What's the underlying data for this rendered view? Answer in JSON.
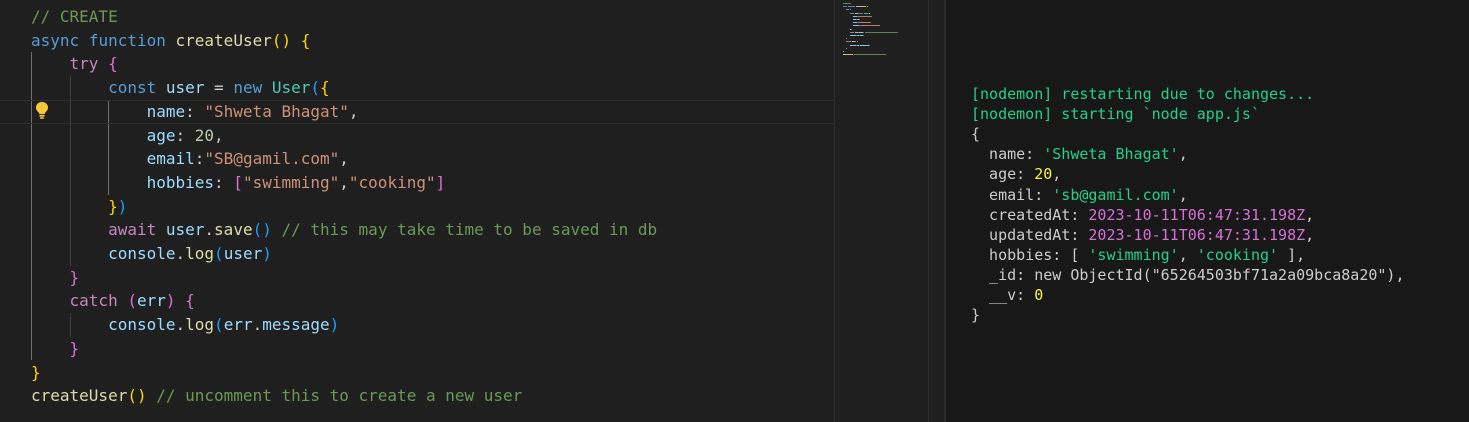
{
  "editor": {
    "lines": [
      {
        "tokens": [
          {
            "t": "// CREATE",
            "c": "t-cm"
          }
        ]
      },
      {
        "tokens": [
          {
            "t": "async",
            "c": "t-kw"
          },
          {
            "t": " "
          },
          {
            "t": "function",
            "c": "t-kw"
          },
          {
            "t": " "
          },
          {
            "t": "createUser",
            "c": "t-fn"
          },
          {
            "t": "()",
            "c": "b1"
          },
          {
            "t": " "
          },
          {
            "t": "{",
            "c": "b1"
          }
        ]
      },
      {
        "tokens": [
          {
            "t": "    "
          },
          {
            "t": "try",
            "c": "t-ctl"
          },
          {
            "t": " "
          },
          {
            "t": "{",
            "c": "b2"
          }
        ]
      },
      {
        "tokens": [
          {
            "t": "        "
          },
          {
            "t": "const",
            "c": "t-kw"
          },
          {
            "t": " "
          },
          {
            "t": "user",
            "c": "t-var"
          },
          {
            "t": " = "
          },
          {
            "t": "new",
            "c": "t-kw"
          },
          {
            "t": " "
          },
          {
            "t": "User",
            "c": "t-cls"
          },
          {
            "t": "(",
            "c": "b3"
          },
          {
            "t": "{",
            "c": "b1"
          }
        ]
      },
      {
        "tokens": [
          {
            "t": "            "
          },
          {
            "t": "name",
            "c": "t-var"
          },
          {
            "t": ": "
          },
          {
            "t": "\"Shweta Bhagat\"",
            "c": "t-str"
          },
          {
            "t": ","
          }
        ],
        "current": true
      },
      {
        "tokens": [
          {
            "t": "            "
          },
          {
            "t": "age",
            "c": "t-var"
          },
          {
            "t": ": "
          },
          {
            "t": "20",
            "c": "t-num"
          },
          {
            "t": ","
          }
        ]
      },
      {
        "tokens": [
          {
            "t": "            "
          },
          {
            "t": "email",
            "c": "t-var"
          },
          {
            "t": ":"
          },
          {
            "t": "\"SB@gamil.com\"",
            "c": "t-str"
          },
          {
            "t": ","
          }
        ]
      },
      {
        "tokens": [
          {
            "t": "            "
          },
          {
            "t": "hobbies",
            "c": "t-var"
          },
          {
            "t": ": "
          },
          {
            "t": "[",
            "c": "b2"
          },
          {
            "t": "\"swimming\"",
            "c": "t-str"
          },
          {
            "t": ","
          },
          {
            "t": "\"cooking\"",
            "c": "t-str"
          },
          {
            "t": "]",
            "c": "b2"
          }
        ]
      },
      {
        "tokens": [
          {
            "t": "        "
          },
          {
            "t": "}",
            "c": "b1"
          },
          {
            "t": ")",
            "c": "b3"
          }
        ]
      },
      {
        "tokens": [
          {
            "t": "        "
          },
          {
            "t": "await",
            "c": "t-ctl"
          },
          {
            "t": " "
          },
          {
            "t": "user",
            "c": "t-var"
          },
          {
            "t": "."
          },
          {
            "t": "save",
            "c": "t-fn"
          },
          {
            "t": "()",
            "c": "b3"
          },
          {
            "t": " "
          },
          {
            "t": "// this may take time to be saved in db",
            "c": "t-cm"
          }
        ]
      },
      {
        "tokens": [
          {
            "t": "        "
          },
          {
            "t": "console",
            "c": "t-var"
          },
          {
            "t": "."
          },
          {
            "t": "log",
            "c": "t-fn"
          },
          {
            "t": "(",
            "c": "b3"
          },
          {
            "t": "user",
            "c": "t-var"
          },
          {
            "t": ")",
            "c": "b3"
          }
        ]
      },
      {
        "tokens": [
          {
            "t": "    "
          },
          {
            "t": "}",
            "c": "b2"
          }
        ]
      },
      {
        "tokens": [
          {
            "t": "    "
          },
          {
            "t": "catch",
            "c": "t-ctl"
          },
          {
            "t": " "
          },
          {
            "t": "(",
            "c": "b2"
          },
          {
            "t": "err",
            "c": "t-var"
          },
          {
            "t": ")",
            "c": "b2"
          },
          {
            "t": " "
          },
          {
            "t": "{",
            "c": "b2"
          }
        ]
      },
      {
        "tokens": [
          {
            "t": "        "
          },
          {
            "t": "console",
            "c": "t-var"
          },
          {
            "t": "."
          },
          {
            "t": "log",
            "c": "t-fn"
          },
          {
            "t": "(",
            "c": "b3"
          },
          {
            "t": "err",
            "c": "t-var"
          },
          {
            "t": "."
          },
          {
            "t": "message",
            "c": "t-var"
          },
          {
            "t": ")",
            "c": "b3"
          }
        ]
      },
      {
        "tokens": [
          {
            "t": "    "
          },
          {
            "t": "}",
            "c": "b2"
          }
        ]
      },
      {
        "tokens": [
          {
            "t": "}",
            "c": "b1"
          }
        ]
      },
      {
        "tokens": [
          {
            "t": "createUser",
            "c": "t-fn"
          },
          {
            "t": "()",
            "c": "b1"
          },
          {
            "t": " "
          },
          {
            "t": "// uncomment this to create a new user",
            "c": "t-cm"
          }
        ]
      }
    ],
    "lightbulb_icon": "lightbulb-icon",
    "lightbulb_color": "#f8c73b"
  },
  "terminal": {
    "lines": [
      {
        "tokens": [
          {
            "t": "[nodemon] restarting due to changes...",
            "c": "tc-green"
          }
        ]
      },
      {
        "tokens": [
          {
            "t": "[nodemon] starting `node app.js`",
            "c": "tc-green"
          }
        ]
      },
      {
        "tokens": [
          {
            "t": "{"
          }
        ]
      },
      {
        "tokens": [
          {
            "t": "  name: "
          },
          {
            "t": "'Shweta Bhagat'",
            "c": "tc-str"
          },
          {
            "t": ","
          }
        ]
      },
      {
        "tokens": [
          {
            "t": "  age: "
          },
          {
            "t": "20",
            "c": "tc-num"
          },
          {
            "t": ","
          }
        ]
      },
      {
        "tokens": [
          {
            "t": "  email: "
          },
          {
            "t": "'sb@gamil.com'",
            "c": "tc-str"
          },
          {
            "t": ","
          }
        ]
      },
      {
        "tokens": [
          {
            "t": "  createdAt: "
          },
          {
            "t": "2023-10-11T06:47:31.198Z",
            "c": "tc-date"
          },
          {
            "t": ","
          }
        ]
      },
      {
        "tokens": [
          {
            "t": "  updatedAt: "
          },
          {
            "t": "2023-10-11T06:47:31.198Z",
            "c": "tc-date"
          },
          {
            "t": ","
          }
        ]
      },
      {
        "tokens": [
          {
            "t": "  hobbies: [ "
          },
          {
            "t": "'swimming'",
            "c": "tc-str"
          },
          {
            "t": ", "
          },
          {
            "t": "'cooking'",
            "c": "tc-str"
          },
          {
            "t": " ],"
          }
        ]
      },
      {
        "tokens": [
          {
            "t": "  _id: new ObjectId(\"65264503bf71a2a09bca8a20\"),"
          }
        ]
      },
      {
        "tokens": [
          {
            "t": "  __v: "
          },
          {
            "t": "0",
            "c": "tc-num"
          }
        ]
      },
      {
        "tokens": [
          {
            "t": "}"
          }
        ]
      }
    ]
  },
  "colors": {
    "editor_bg": "#1f1f1f",
    "terminal_bg": "#181818",
    "terminal_green": "#23d18b"
  }
}
